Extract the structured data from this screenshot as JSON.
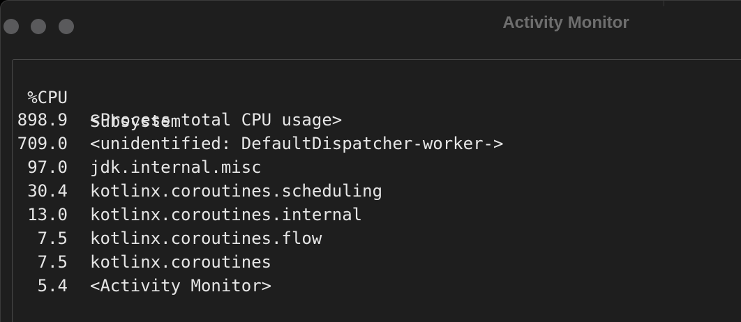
{
  "window": {
    "title": "Activity Monitor"
  },
  "table": {
    "headers": {
      "cpu": "%CPU",
      "subsystem": "Subsystem"
    },
    "rows": [
      {
        "cpu": "898.9",
        "subsystem": "<Process total CPU usage>"
      },
      {
        "cpu": "709.0",
        "subsystem": "<unidentified: DefaultDispatcher-worker->"
      },
      {
        "cpu": "97.0",
        "subsystem": "jdk.internal.misc"
      },
      {
        "cpu": "30.4",
        "subsystem": "kotlinx.coroutines.scheduling"
      },
      {
        "cpu": "13.0",
        "subsystem": "kotlinx.coroutines.internal"
      },
      {
        "cpu": "7.5",
        "subsystem": "kotlinx.coroutines.flow"
      },
      {
        "cpu": "7.5",
        "subsystem": "kotlinx.coroutines"
      },
      {
        "cpu": "5.4",
        "subsystem": "<Activity Monitor>"
      }
    ]
  },
  "colors": {
    "background": "#1e1e1e",
    "text": "#e6e6e6",
    "title": "#6e6e6e",
    "traffic_light_inactive": "#5a5a5c"
  }
}
